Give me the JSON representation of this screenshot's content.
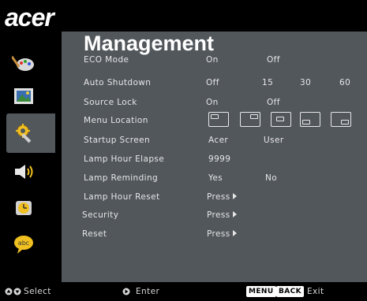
{
  "logo": "acer",
  "title": "Management",
  "sidebar": [
    {
      "name": "color-icon"
    },
    {
      "name": "image-icon"
    },
    {
      "name": "management-icon",
      "active": true
    },
    {
      "name": "audio-icon"
    },
    {
      "name": "timer-icon"
    },
    {
      "name": "language-icon"
    }
  ],
  "rows": {
    "eco_mode": {
      "label": "ECO Mode",
      "options": [
        "On",
        "Off"
      ]
    },
    "auto_shutdown": {
      "label": "Auto Shutdown",
      "options": [
        "Off",
        "15",
        "30",
        "60"
      ]
    },
    "source_lock": {
      "label": "Source Lock",
      "options": [
        "On",
        "Off"
      ]
    },
    "menu_location": {
      "label": "Menu Location"
    },
    "startup_screen": {
      "label": "Startup Screen",
      "options": [
        "Acer",
        "User"
      ]
    },
    "lamp_hour_elapse": {
      "label": "Lamp Hour Elapse",
      "value": "9999"
    },
    "lamp_reminding": {
      "label": "Lamp Reminding",
      "options": [
        "Yes",
        "No"
      ]
    },
    "lamp_hour_reset": {
      "label": "Lamp Hour Reset",
      "action": "Press"
    },
    "security": {
      "label": "Security",
      "action": "Press"
    },
    "reset": {
      "label": "Reset",
      "action": "Press"
    }
  },
  "footer": {
    "select": "Select",
    "enter": "Enter",
    "menu_key": "MENU",
    "back_key": "BACK",
    "exit": "Exit"
  }
}
